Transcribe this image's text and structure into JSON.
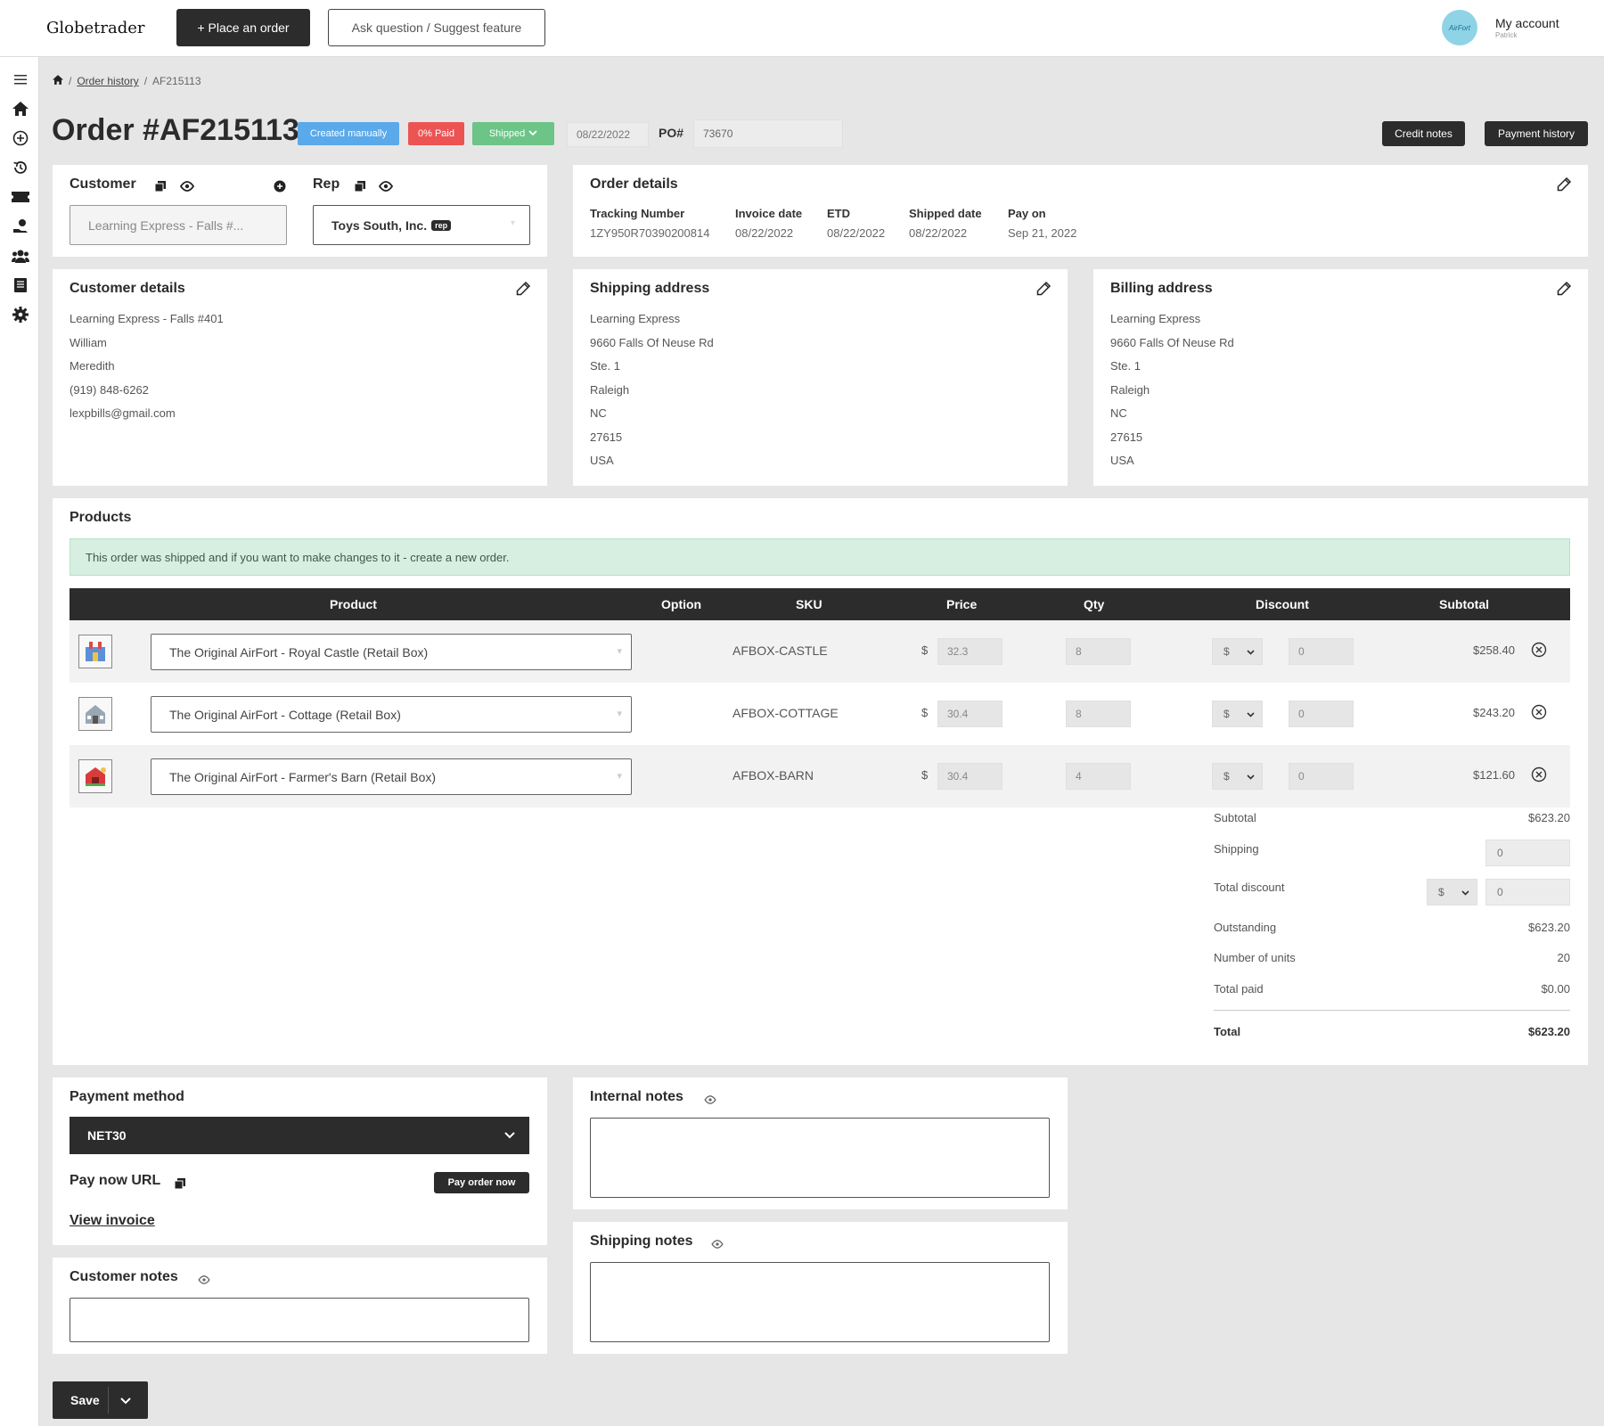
{
  "app": {
    "brand": "Globetrader"
  },
  "topbar": {
    "place_order": "+ Place an order",
    "ask_question": "Ask question / Suggest feature",
    "avatar_text": "AirFort",
    "account_label": "My account",
    "account_user": "Patrick"
  },
  "sidebar": {
    "icons": [
      "menu-icon",
      "home-icon",
      "plus-circle-icon",
      "history-icon",
      "ticket-icon",
      "hand-coin-icon",
      "users-icon",
      "book-icon",
      "gear-icon"
    ]
  },
  "breadcrumb": {
    "home_sep": "/",
    "order_history": "Order history",
    "sep": "/",
    "current": "AF215113"
  },
  "header": {
    "title": "Order #AF215113",
    "badge_created": "Created manually",
    "badge_paid": "0% Paid",
    "badge_shipped": "Shipped",
    "date": "08/22/2022",
    "po_label": "PO#",
    "po_value": "73670",
    "credit_notes": "Credit notes",
    "payment_history": "Payment history"
  },
  "customer_card": {
    "customer_label": "Customer",
    "customer_value": "Learning Express - Falls #...",
    "rep_label": "Rep",
    "rep_value": "Toys South, Inc.",
    "rep_tag": "rep"
  },
  "order_details": {
    "title": "Order details",
    "fields": [
      {
        "label": "Tracking Number",
        "value": "1ZY950R70390200814"
      },
      {
        "label": "Invoice date",
        "value": "08/22/2022"
      },
      {
        "label": "ETD",
        "value": "08/22/2022"
      },
      {
        "label": "Shipped date",
        "value": "08/22/2022"
      },
      {
        "label": "Pay on",
        "value": "Sep 21, 2022"
      }
    ]
  },
  "customer_details": {
    "title": "Customer details",
    "lines": [
      "Learning Express - Falls #401",
      "William",
      "Meredith",
      "(919) 848-6262",
      "lexpbills@gmail.com"
    ]
  },
  "shipping_address": {
    "title": "Shipping address",
    "lines": [
      "Learning Express",
      "9660 Falls Of Neuse Rd",
      "Ste. 1",
      "Raleigh",
      "NC",
      "27615",
      "USA"
    ]
  },
  "billing_address": {
    "title": "Billing address",
    "lines": [
      "Learning Express",
      "9660 Falls Of Neuse Rd",
      "Ste. 1",
      "Raleigh",
      "NC",
      "27615",
      "USA"
    ]
  },
  "products": {
    "title": "Products",
    "alert": "This order was shipped and if you want to make changes to it - create a new order.",
    "columns": [
      "Product",
      "Option",
      "SKU",
      "Price",
      "Qty",
      "Discount",
      "Subtotal"
    ],
    "rows": [
      {
        "product": "The Original AirFort - Royal Castle (Retail Box)",
        "sku": "AFBOX-CASTLE",
        "currency": "$",
        "price": "32.3",
        "qty": "8",
        "discount_type": "$",
        "discount": "0",
        "subtotal": "$258.40"
      },
      {
        "product": "The Original AirFort - Cottage (Retail Box)",
        "sku": "AFBOX-COTTAGE",
        "currency": "$",
        "price": "30.4",
        "qty": "8",
        "discount_type": "$",
        "discount": "0",
        "subtotal": "$243.20"
      },
      {
        "product": "The Original AirFort - Farmer's Barn (Retail Box)",
        "sku": "AFBOX-BARN",
        "currency": "$",
        "price": "30.4",
        "qty": "4",
        "discount_type": "$",
        "discount": "0",
        "subtotal": "$121.60"
      }
    ],
    "totals": {
      "subtotal_label": "Subtotal",
      "subtotal": "$623.20",
      "shipping_label": "Shipping",
      "shipping": "0",
      "total_discount_label": "Total discount",
      "total_discount_type": "$",
      "total_discount": "0",
      "outstanding_label": "Outstanding",
      "outstanding": "$623.20",
      "units_label": "Number of units",
      "units": "20",
      "total_paid_label": "Total paid",
      "total_paid": "$0.00",
      "total_label": "Total",
      "total": "$623.20"
    }
  },
  "payment": {
    "title": "Payment method",
    "method": "NET30",
    "pay_now_label": "Pay now URL",
    "pay_order_now": "Pay order now",
    "view_invoice": "View invoice"
  },
  "notes": {
    "internal_title": "Internal notes",
    "shipping_title": "Shipping notes",
    "customer_title": "Customer notes"
  },
  "footer": {
    "save": "Save"
  },
  "colors": {
    "dark": "#2c2c2c",
    "created": "#5aa9ea",
    "paid": "#ec5454",
    "shipped": "#6cc487",
    "alert_bg": "#d6efe0"
  }
}
